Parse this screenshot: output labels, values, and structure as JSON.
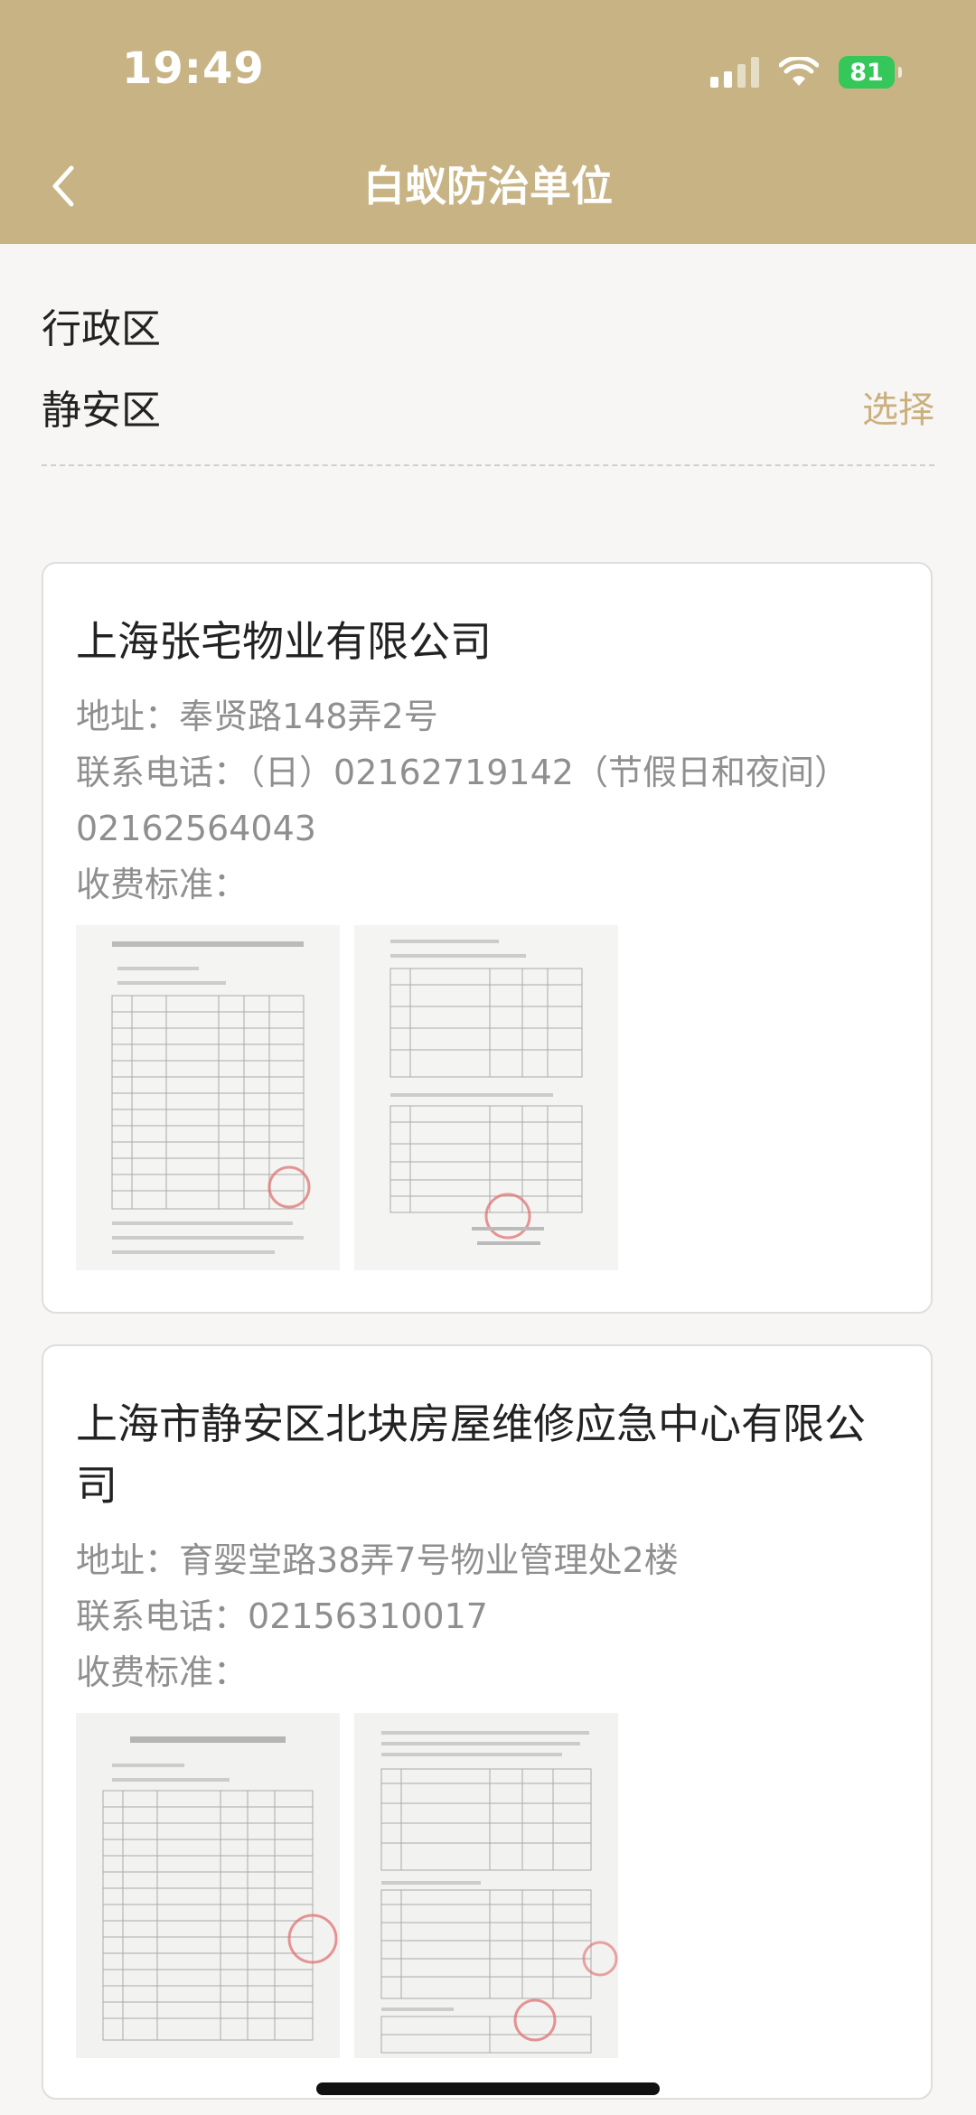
{
  "status_bar": {
    "time": "19:49",
    "battery": "81"
  },
  "nav": {
    "title": "白蚁防治单位",
    "back_icon": "chevron-left-icon"
  },
  "filter": {
    "label": "行政区",
    "value": "静安区",
    "select_label": "选择"
  },
  "colors": {
    "header_bg": "#c8b384",
    "accent": "#c9b07e",
    "battery": "#35c759"
  },
  "companies": [
    {
      "name": "上海张宅物业有限公司",
      "address_label": "地址：",
      "address": "奉贤路148弄2号",
      "phone_label": "联系电话：",
      "phone_line1": "（日）02162719142（节假日和夜间）",
      "phone_line2": "02162564043",
      "fee_label": "收费标准："
    },
    {
      "name_line1": "上海市静安区北块房屋维修应急中心有限公",
      "name_line2": "司",
      "address_label": "地址：",
      "address": "育婴堂路38弄7号物业管理处2楼",
      "phone_label": "联系电话：",
      "phone": "02156310017",
      "fee_label": "收费标准："
    }
  ]
}
